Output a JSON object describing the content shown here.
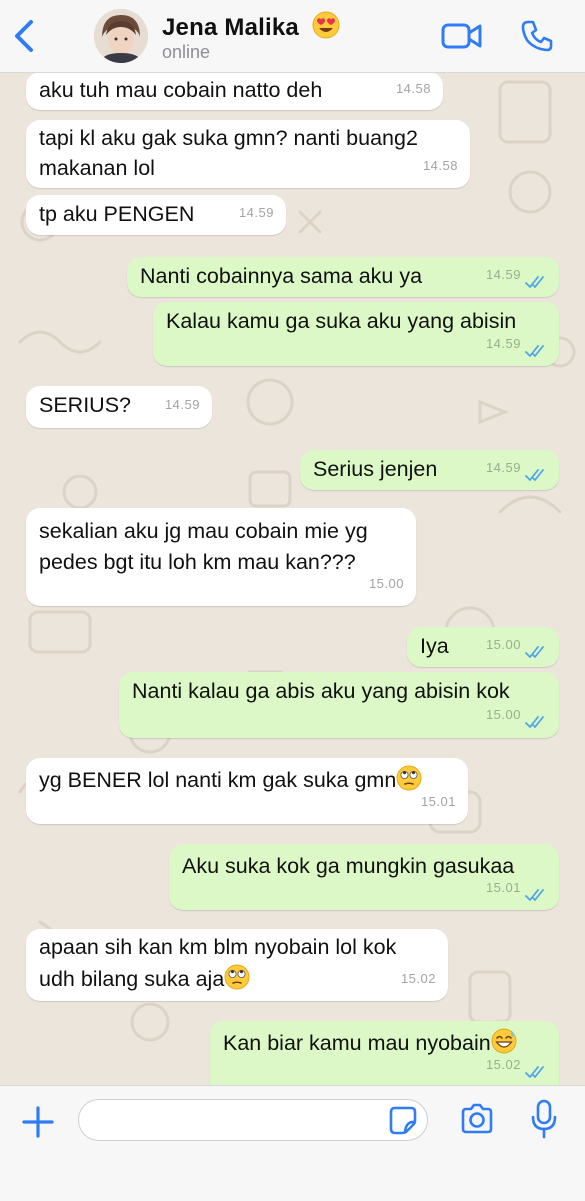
{
  "header": {
    "contact_name": "Jena Malika",
    "status": "online"
  },
  "composer": {
    "placeholder": ""
  },
  "messages": [
    {
      "dir": "in",
      "text": "aku tuh mau cobain natto deh",
      "time": "14.58"
    },
    {
      "dir": "in",
      "text": "tapi kl aku gak suka gmn? nanti buang2",
      "text2": "makanan lol",
      "time": "14.58"
    },
    {
      "dir": "in",
      "text": "tp aku PENGEN",
      "time": "14.59"
    },
    {
      "dir": "out",
      "text": "Nanti cobainnya sama aku ya",
      "time": "14.59"
    },
    {
      "dir": "out",
      "text": "Kalau kamu ga suka aku yang abisin",
      "time": "14.59"
    },
    {
      "dir": "in",
      "text": "SERIUS?",
      "time": "14.59"
    },
    {
      "dir": "out",
      "text": "Serius jenjen",
      "time": "14.59"
    },
    {
      "dir": "in",
      "text": "sekalian aku jg mau cobain mie yg",
      "text2": "pedes bgt itu loh km mau kan???",
      "time": "15.00"
    },
    {
      "dir": "out",
      "text": "Iya",
      "time": "15.00"
    },
    {
      "dir": "out",
      "text": "Nanti kalau ga abis aku yang abisin kok",
      "time": "15.00"
    },
    {
      "dir": "in",
      "text": "yg BENER lol nanti km gak suka gmn",
      "time": "15.01"
    },
    {
      "dir": "out",
      "text": "Aku suka kok ga mungkin gasukaa",
      "time": "15.01"
    },
    {
      "dir": "in",
      "text": "apaan sih kan km blm nyobain lol kok",
      "text2": "udh bilang suka aja",
      "time": "15.02"
    },
    {
      "dir": "out",
      "text": "Kan biar kamu mau nyobain",
      "time": "15.02"
    }
  ],
  "colors": {
    "accent": "#2f7cf6",
    "outgoing_bubble": "#dcf8c6",
    "incoming_bubble": "#ffffff",
    "chat_background": "#ece5dc",
    "read_ticks": "#4fa6e6"
  },
  "icons": {
    "back": "chevron-left-icon",
    "video": "video-call-icon",
    "call": "phone-icon",
    "attach": "plus-icon",
    "sticker": "sticker-icon",
    "camera": "camera-icon",
    "mic": "microphone-icon",
    "status_emoji": "heart-eyes-emoji",
    "eye_roll": "face-with-rolling-eyes-emoji",
    "sweat_smile": "grinning-face-with-sweat-emoji"
  }
}
